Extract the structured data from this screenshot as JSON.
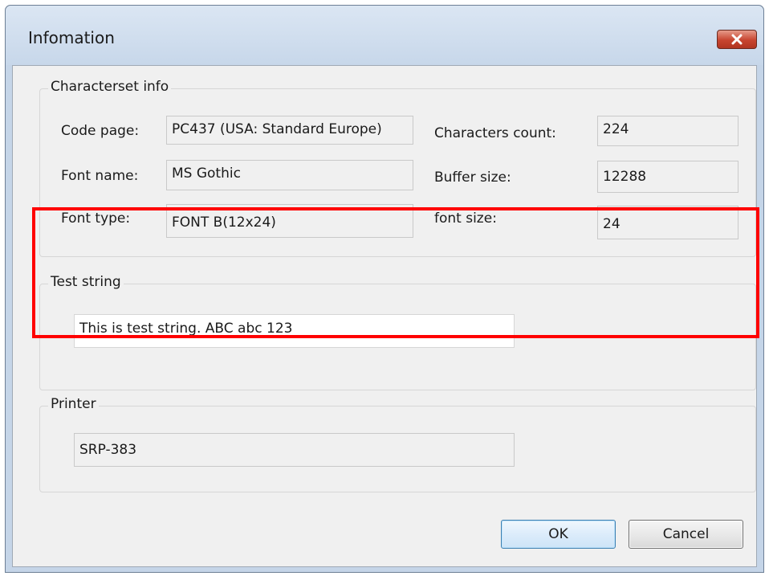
{
  "window": {
    "title": "Infomation",
    "close_icon": "close-icon"
  },
  "charset_info": {
    "legend": "Characterset info",
    "code_page_label": "Code page:",
    "code_page_value": "PC437 (USA: Standard Europe)",
    "font_name_label": "Font name:",
    "font_name_value": "MS Gothic",
    "font_type_label": "Font type:",
    "font_type_value": "FONT B(12x24)",
    "characters_count_label": "Characters count:",
    "characters_count_value": "224",
    "buffer_size_label": "Buffer size:",
    "buffer_size_value": "12288",
    "font_size_label": "font size:",
    "font_size_value": "24"
  },
  "test_string": {
    "legend": "Test string",
    "value": "This is test string. ABC abc 123"
  },
  "printer": {
    "legend": "Printer",
    "value": "SRP-383"
  },
  "buttons": {
    "ok": "OK",
    "cancel": "Cancel"
  },
  "colors": {
    "highlight": "#ff0000",
    "close_button": "#c7452f"
  }
}
